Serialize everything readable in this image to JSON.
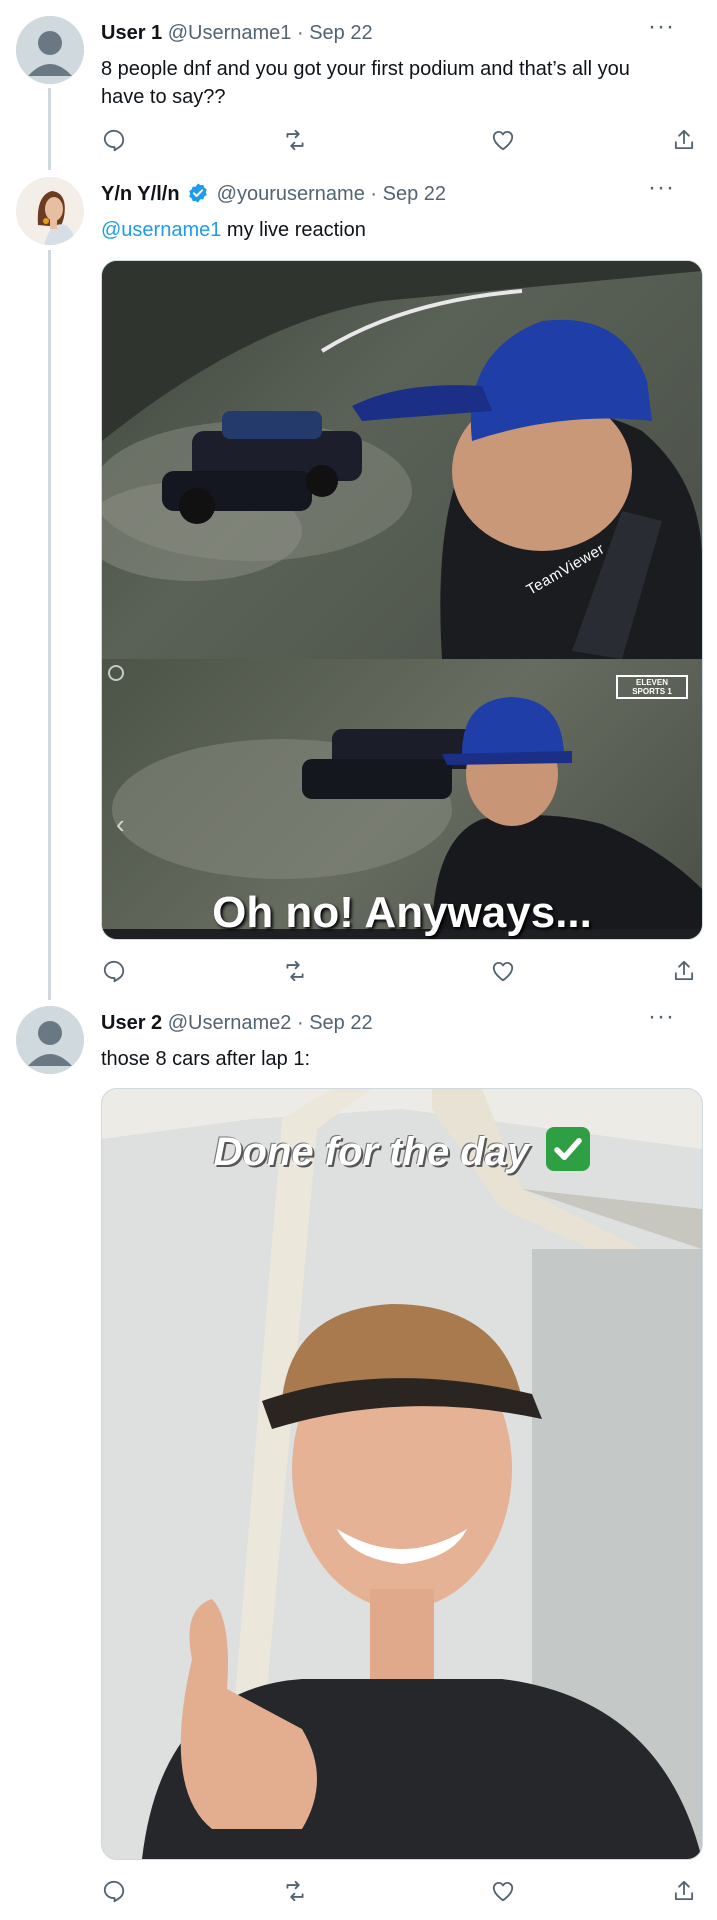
{
  "tweets": [
    {
      "name": "User 1",
      "handle": "@Username1",
      "separator": "·",
      "date": "Sep 22",
      "more": "···",
      "text": "8 people dnf and you got your first podium and that’s all you have to say??"
    },
    {
      "name": "Y/n Y/l/n",
      "handle": "@yourusername",
      "separator": "·",
      "date": "Sep 22",
      "more": "···",
      "mention": "@username1",
      "text": " my live reaction",
      "media": {
        "top_badge": "TeamViewer",
        "broadcaster": "ELEVEN SPORTS 1",
        "caption": "Oh no! Anyways..."
      }
    },
    {
      "name": "User 2",
      "handle": "@Username2",
      "separator": "·",
      "date": "Sep 22",
      "more": "···",
      "text": "those 8 cars after lap 1:",
      "media": {
        "caption": "Done for the day",
        "emoji": "✅"
      }
    }
  ],
  "icons": {
    "reply": "reply-icon",
    "retweet": "retweet-icon",
    "like": "heart-icon",
    "share": "share-icon"
  },
  "colors": {
    "accent": "#1d9bf0",
    "muted": "#536471",
    "thread_line": "#cfd9de",
    "check_green": "#2ea043"
  }
}
